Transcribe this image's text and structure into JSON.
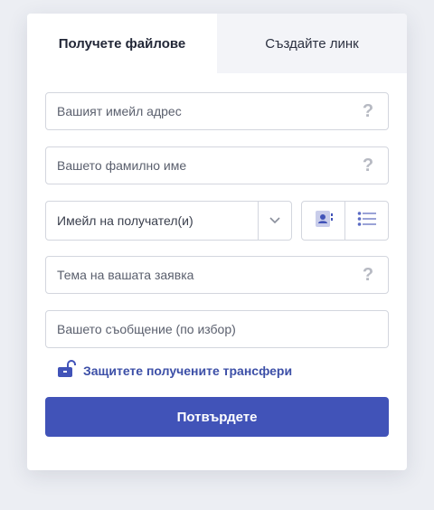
{
  "tabs": [
    {
      "label": "Получете файлове",
      "active": true
    },
    {
      "label": "Създайте линк",
      "active": false
    }
  ],
  "form": {
    "email_placeholder": "Вашият имейл адрес",
    "lastname_placeholder": "Вашето фамилно име",
    "recipients_placeholder": "Имейл на получател(и)",
    "subject_placeholder": "Тема на вашата заявка",
    "message_placeholder": "Вашето съобщение (по избор)",
    "help_glyph": "?",
    "protect_label": "Защитете получените трансфери",
    "submit_label": "Потвърдете"
  },
  "icons": {
    "help": "question-icon",
    "chevron": "chevron-down-icon",
    "contacts": "contact-book-icon",
    "list": "list-icon",
    "lock": "unlock-icon"
  },
  "colors": {
    "accent": "#4153b8",
    "link": "#3c4fa7",
    "background": "#eceef3",
    "border": "#d3d6de"
  }
}
